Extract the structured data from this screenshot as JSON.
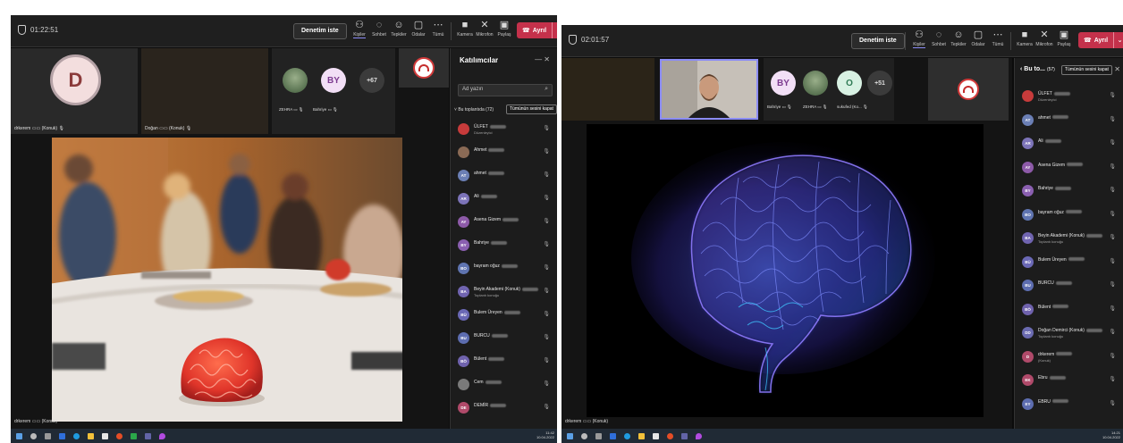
{
  "left": {
    "timer": "01:22:51",
    "denetim_label": "Denetim iste",
    "toolbar": [
      {
        "label": "Kişiler",
        "icon": "people-icon"
      },
      {
        "label": "Sohbet",
        "icon": "chat-icon"
      },
      {
        "label": "Tepkiler",
        "icon": "reactions-icon"
      },
      {
        "label": "Odalar",
        "icon": "rooms-icon"
      },
      {
        "label": "Tümü",
        "icon": "more-icon"
      },
      {
        "label": "Kamera",
        "icon": "camera-icon"
      },
      {
        "label": "Mikrofon",
        "icon": "microphone-icon"
      },
      {
        "label": "Paylaş",
        "icon": "share-icon"
      }
    ],
    "leave_label": "Ayrıl",
    "tiles": {
      "tile1_initial": "D",
      "tile1_name": "drkerem",
      "tile1_guest": "(Konuk)",
      "tile2_name": "Doğan",
      "tile2_guest": "(Konuk)",
      "av_by": "BY",
      "av_count": "+67",
      "name_zehra": "ZEHRA",
      "name_bahriye": "Bahriye"
    },
    "share_name": "drkerem",
    "share_guest": "(Konuk)",
    "panel": {
      "title": "Katılımcılar",
      "search_placeholder": "Ad yazın",
      "section": "Bu toplantıda (72)",
      "mute_all": "Tümünün sesini kapat",
      "participants": [
        {
          "initials": "",
          "name": "ÜLFET",
          "sub": "Düzenleyici",
          "color": "#c73b3b"
        },
        {
          "initials": "",
          "name": "Ahmet",
          "sub": "",
          "color": "#8a6a55"
        },
        {
          "initials": "AT",
          "name": "ahmet",
          "sub": "",
          "color": "#6b7fb5"
        },
        {
          "initials": "AR",
          "name": "Ali",
          "sub": "",
          "color": "#7c73b8"
        },
        {
          "initials": "AY",
          "name": "Asena Gizem",
          "sub": "",
          "color": "#8d5aa8"
        },
        {
          "initials": "BY",
          "name": "Bahriye",
          "sub": "",
          "color": "#8a5fb0"
        },
        {
          "initials": "BO",
          "name": "bayram oğuz",
          "sub": "",
          "color": "#5f74b0"
        },
        {
          "initials": "BA",
          "name": "Beyin Akademi (Konuk)",
          "sub": "Toplantı konuğu",
          "color": "#7064b0"
        },
        {
          "initials": "BÜ",
          "name": "Bulem Üreyen",
          "sub": "",
          "color": "#6a68b5"
        },
        {
          "initials": "BU",
          "name": "BURCU",
          "sub": "",
          "color": "#5d6db0"
        },
        {
          "initials": "BÖ",
          "name": "Bülent",
          "sub": "",
          "color": "#6f62ad"
        },
        {
          "initials": "",
          "name": "Cem",
          "sub": "",
          "color": "#7a7a7a"
        },
        {
          "initials": "DE",
          "name": "DEMİR",
          "sub": "",
          "color": "#b04a6a"
        }
      ]
    },
    "clock": [
      "11:42",
      "10.04.2022"
    ]
  },
  "right": {
    "timer": "02:01:57",
    "denetim_label": "Denetim iste",
    "toolbar": [
      {
        "label": "Kişiler",
        "icon": "people-icon"
      },
      {
        "label": "Sohbet",
        "icon": "chat-icon"
      },
      {
        "label": "Tepkiler",
        "icon": "reactions-icon"
      },
      {
        "label": "Odalar",
        "icon": "rooms-icon"
      },
      {
        "label": "Tümü",
        "icon": "more-icon"
      },
      {
        "label": "Kamera",
        "icon": "camera-icon"
      },
      {
        "label": "Mikrofon",
        "icon": "microphone-icon"
      },
      {
        "label": "Paylaş",
        "icon": "share-icon"
      }
    ],
    "leave_label": "Ayrıl",
    "tiles": {
      "av_by": "BY",
      "av_o": "O",
      "av_count": "+51",
      "name_bahriye": "Bahriye",
      "name_zehra": "ZEHRA",
      "name_sukufed": "sukufed (Ko..."
    },
    "share_name": "drkerem",
    "share_guest": "(Konuk)",
    "panel": {
      "title": "Bu to...",
      "count": "(57)",
      "mute_all": "Tümünün sesini kapat",
      "participants": [
        {
          "initials": "",
          "name": "ÜLFET",
          "sub": "Düzenleyici",
          "color": "#c73b3b"
        },
        {
          "initials": "AT",
          "name": "ahmet",
          "sub": "",
          "color": "#6b7fb5"
        },
        {
          "initials": "AR",
          "name": "Ali",
          "sub": "",
          "color": "#7c73b8"
        },
        {
          "initials": "AY",
          "name": "Asena Gizem",
          "sub": "",
          "color": "#8d5aa8"
        },
        {
          "initials": "BY",
          "name": "Bahriye",
          "sub": "",
          "color": "#8a5fb0"
        },
        {
          "initials": "BO",
          "name": "bayram oğuz",
          "sub": "",
          "color": "#5f74b0"
        },
        {
          "initials": "BA",
          "name": "Beyin Akademi (Konuk)",
          "sub": "Toplantı konuğu",
          "color": "#7064b0"
        },
        {
          "initials": "BÜ",
          "name": "Bulem Üreyen",
          "sub": "",
          "color": "#6a68b5"
        },
        {
          "initials": "BU",
          "name": "BURCU",
          "sub": "",
          "color": "#5d6db0"
        },
        {
          "initials": "BÖ",
          "name": "Bülent",
          "sub": "",
          "color": "#6f62ad"
        },
        {
          "initials": "DD",
          "name": "Doğan Demirci (Konuk)",
          "sub": "Toplantı konuğu",
          "color": "#6a6ab0"
        },
        {
          "initials": "D",
          "name": "drkerem",
          "sub": "(Konuk)",
          "color": "#b04a6a"
        },
        {
          "initials": "EK",
          "name": "Ebru",
          "sub": "",
          "color": "#b04a6a"
        },
        {
          "initials": "EY",
          "name": "EBRU",
          "sub": "",
          "color": "#5d6db0"
        }
      ]
    },
    "clock": [
      "14:21",
      "10.04.2022"
    ]
  },
  "colors": {
    "leave": "#c4314b",
    "accent": "#8b8cf7",
    "panel": "#1c1c1c"
  }
}
